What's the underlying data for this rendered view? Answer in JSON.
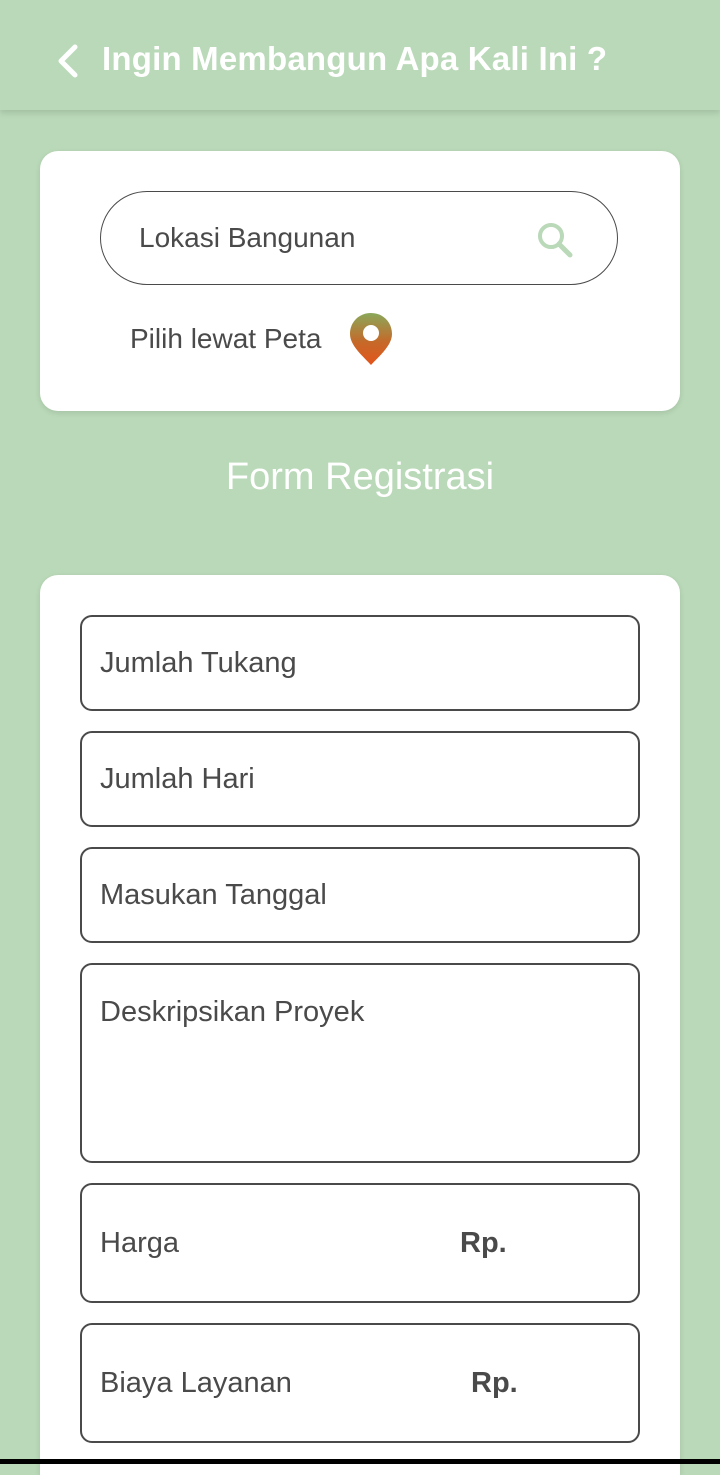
{
  "colors": {
    "background": "#b9d9b8",
    "card": "#ffffff",
    "text": "#4a4a4a",
    "search_icon": "#b9d9b8",
    "pin_top": "#8aa85a",
    "pin_bottom": "#e4541b"
  },
  "header": {
    "back_icon": "chevron-left-icon",
    "title": "Ingin Membangun Apa Kali Ini ?"
  },
  "location": {
    "search_placeholder": "Lokasi Bangunan",
    "search_icon": "search-icon",
    "map_label": "Pilih lewat Peta",
    "map_icon": "map-pin-icon"
  },
  "form": {
    "title": "Form Registrasi",
    "workers_placeholder": "Jumlah Tukang",
    "days_placeholder": "Jumlah Hari",
    "date_placeholder": "Masukan Tanggal",
    "description_placeholder": "Deskripsikan Proyek",
    "price_label": "Harga",
    "price_currency": "Rp.",
    "service_fee_label": "Biaya Layanan",
    "service_fee_currency": "Rp."
  }
}
